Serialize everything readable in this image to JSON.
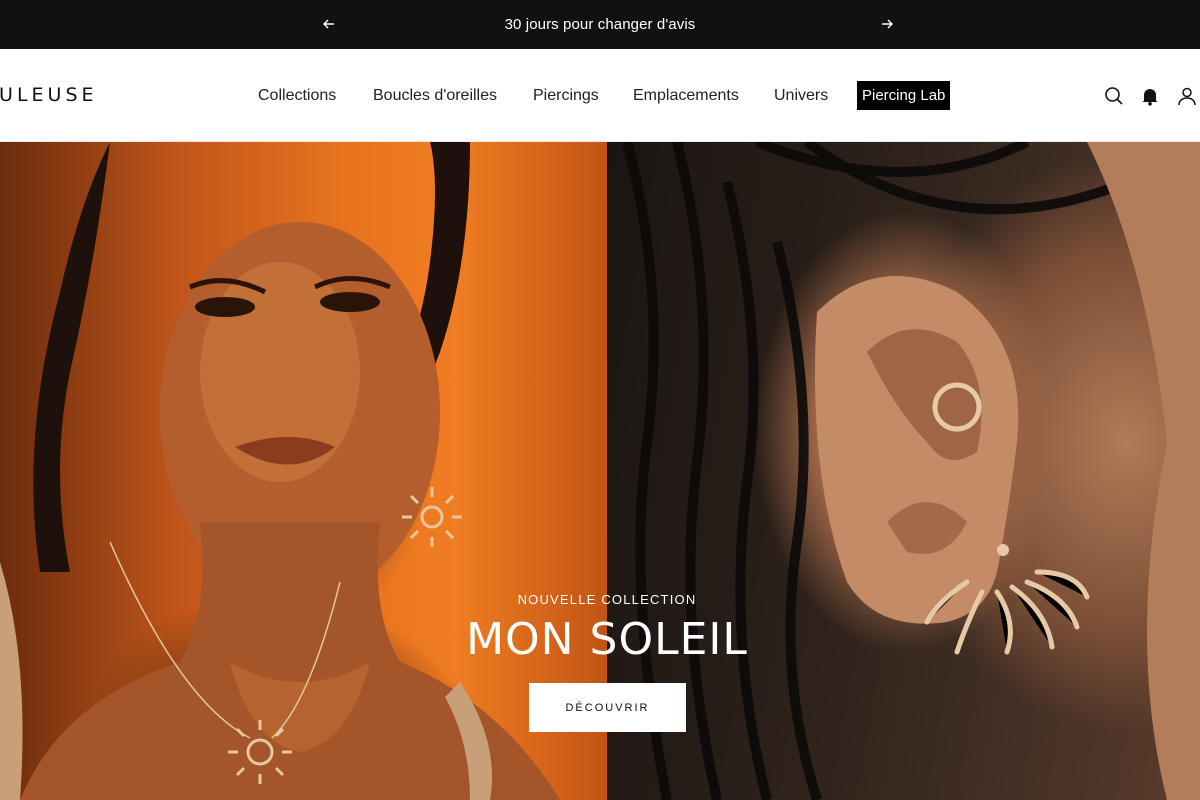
{
  "announcement": {
    "message": "30 jours pour changer d'avis",
    "prev_icon": "arrow-left-icon",
    "next_icon": "arrow-right-icon"
  },
  "header": {
    "logo_text": "BULEUSE",
    "nav": [
      {
        "label": "Collections"
      },
      {
        "label": "Boucles d'oreilles"
      },
      {
        "label": "Piercings"
      },
      {
        "label": "Emplacements"
      },
      {
        "label": "Univers"
      },
      {
        "label": "Piercing Lab"
      }
    ],
    "icons": [
      "search-icon",
      "bell-icon",
      "account-icon"
    ]
  },
  "hero": {
    "eyebrow": "NOUVELLE COLLECTION",
    "title": "MON SOLEIL",
    "cta_label": "DÉCOUVRIR"
  },
  "colors": {
    "announcement_bg": "#111111",
    "header_bg": "#ffffff",
    "lab_badge_bg": "#000000",
    "hero_left_orange": "#f07d22",
    "cta_bg": "#ffffff"
  }
}
